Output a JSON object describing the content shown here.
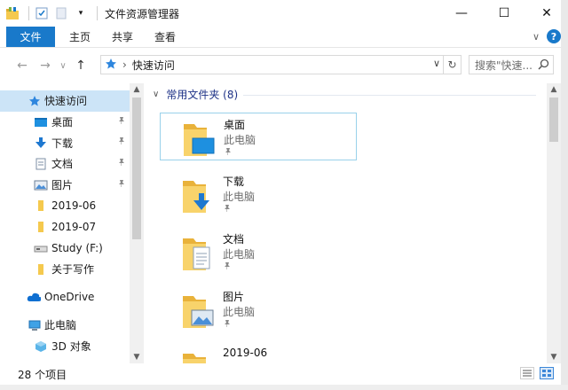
{
  "window": {
    "title": "文件资源管理器",
    "controls": {
      "minimize": "—",
      "maximize": "☐",
      "close": "✕"
    }
  },
  "ribbon": {
    "tabs": [
      "文件",
      "主页",
      "共享",
      "查看"
    ],
    "expand_glyph": "∨",
    "help_glyph": "?"
  },
  "address": {
    "back": "←",
    "forward": "→",
    "recent": "∨",
    "up": "↑",
    "separator": "›",
    "path": "快速访问",
    "dropdown": "∨",
    "refresh": "↻",
    "search_placeholder": "搜索\"快速..."
  },
  "nav": {
    "quick_access": "快速访问",
    "pinned": [
      {
        "label": "桌面",
        "icon": "desktop-icon"
      },
      {
        "label": "下载",
        "icon": "download-icon"
      },
      {
        "label": "文档",
        "icon": "document-icon"
      },
      {
        "label": "图片",
        "icon": "picture-icon"
      }
    ],
    "folders": [
      "2019-06",
      "2019-07"
    ],
    "drive": "Study (F:)",
    "writing": "关于写作",
    "onedrive": "OneDrive",
    "this_pc": "此电脑",
    "objects3d": "3D 对象",
    "pin_glyph": "📌",
    "scroll_up": "▲",
    "scroll_down": "▼"
  },
  "content": {
    "group_title": "常用文件夹 (8)",
    "group_chevron": "∨",
    "tiles": [
      {
        "name": "桌面",
        "location": "此电脑",
        "icon": "desktop-folder-icon"
      },
      {
        "name": "下载",
        "location": "此电脑",
        "icon": "download-folder-icon"
      },
      {
        "name": "文档",
        "location": "此电脑",
        "icon": "document-folder-icon"
      },
      {
        "name": "图片",
        "location": "此电脑",
        "icon": "picture-folder-icon"
      },
      {
        "name": "2019-06",
        "location": "",
        "icon": "folder-icon"
      }
    ]
  },
  "status": {
    "item_count": "28 个项目"
  },
  "colors": {
    "accent": "#1979ca",
    "selection": "#cce4f7",
    "tile_border": "#99d1ea",
    "group_header": "#1e3287",
    "folder": "#f5c94e"
  }
}
